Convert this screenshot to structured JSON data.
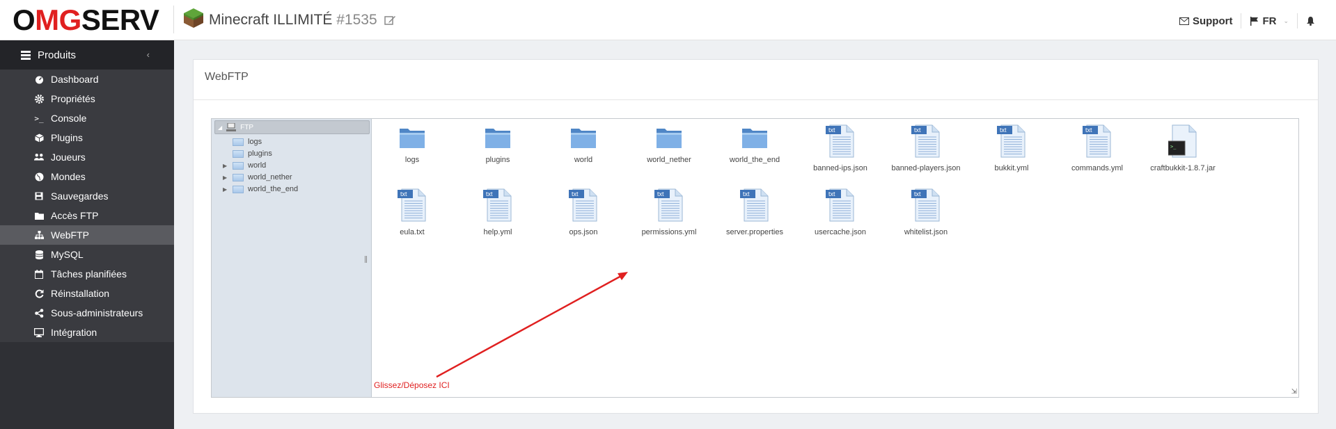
{
  "header": {
    "logo": {
      "o": "O",
      "mg": "MG",
      "serv": "SERV"
    },
    "server_name": "Minecraft ILLIMITÉ",
    "server_id": "#1535",
    "support_label": "Support",
    "language_label": "FR"
  },
  "sidebar": {
    "section_label": "Produits",
    "items": [
      {
        "label": "Dashboard",
        "icon": "dashboard-icon"
      },
      {
        "label": "Propriétés",
        "icon": "gear-icon"
      },
      {
        "label": "Console",
        "icon": "terminal-icon"
      },
      {
        "label": "Plugins",
        "icon": "cube-icon"
      },
      {
        "label": "Joueurs",
        "icon": "users-icon"
      },
      {
        "label": "Mondes",
        "icon": "globe-icon"
      },
      {
        "label": "Sauvegardes",
        "icon": "save-icon"
      },
      {
        "label": "Accès FTP",
        "icon": "folder-icon"
      },
      {
        "label": "WebFTP",
        "icon": "sitemap-icon",
        "active": true
      },
      {
        "label": "MySQL",
        "icon": "database-icon"
      },
      {
        "label": "Tâches planifiées",
        "icon": "calendar-icon"
      },
      {
        "label": "Réinstallation",
        "icon": "refresh-icon"
      },
      {
        "label": "Sous-administrateurs",
        "icon": "share-icon"
      },
      {
        "label": "Intégration",
        "icon": "desktop-icon"
      }
    ]
  },
  "panel": {
    "title": "WebFTP"
  },
  "tree": {
    "root": "FTP",
    "nodes": [
      {
        "label": "logs",
        "expandable": false
      },
      {
        "label": "plugins",
        "expandable": false
      },
      {
        "label": "world",
        "expandable": true
      },
      {
        "label": "world_nether",
        "expandable": true
      },
      {
        "label": "world_the_end",
        "expandable": true
      }
    ]
  },
  "files": [
    {
      "name": "logs",
      "type": "folder"
    },
    {
      "name": "plugins",
      "type": "folder"
    },
    {
      "name": "world",
      "type": "folder"
    },
    {
      "name": "world_nether",
      "type": "folder"
    },
    {
      "name": "world_the_end",
      "type": "folder"
    },
    {
      "name": "banned-ips.json",
      "type": "txt"
    },
    {
      "name": "banned-players.json",
      "type": "txt"
    },
    {
      "name": "bukkit.yml",
      "type": "txt"
    },
    {
      "name": "commands.yml",
      "type": "txt"
    },
    {
      "name": "craftbukkit-1.8.7.jar",
      "type": "jar"
    },
    {
      "name": "eula.txt",
      "type": "txt"
    },
    {
      "name": "help.yml",
      "type": "txt"
    },
    {
      "name": "ops.json",
      "type": "txt"
    },
    {
      "name": "permissions.yml",
      "type": "txt"
    },
    {
      "name": "server.properties",
      "type": "txt"
    },
    {
      "name": "usercache.json",
      "type": "txt"
    },
    {
      "name": "whitelist.json",
      "type": "txt"
    }
  ],
  "txt_badge": "txt",
  "drop_hint": "Glissez/Déposez ICI",
  "colors": {
    "accent_red": "#e02020",
    "sidebar_bg": "#2f3035",
    "active_item": "#5a5b60"
  }
}
